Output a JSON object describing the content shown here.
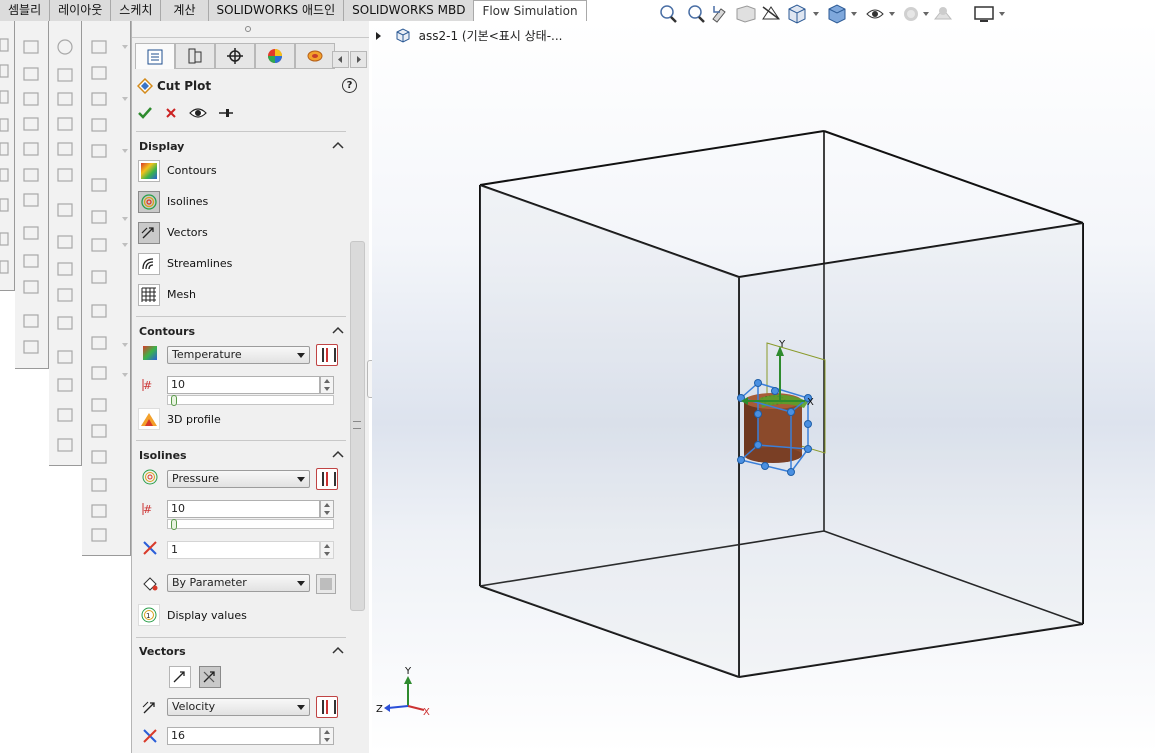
{
  "tabs": [
    {
      "label": "셈블리"
    },
    {
      "label": "레이아웃"
    },
    {
      "label": "스케치"
    },
    {
      "label": "계산"
    },
    {
      "label": "SOLIDWORKS 애드인"
    },
    {
      "label": "SOLIDWORKS MBD"
    },
    {
      "label": "Flow Simulation"
    }
  ],
  "tree": {
    "item_label": "ass2-1  (기본<표시 상태-..."
  },
  "panel": {
    "title": "Cut Plot",
    "help": "?",
    "display": {
      "title": "Display",
      "items": [
        {
          "label": "Contours",
          "icon": "contours-icon",
          "pressed": false
        },
        {
          "label": "Isolines",
          "icon": "isolines-icon",
          "pressed": true
        },
        {
          "label": "Vectors",
          "icon": "vectors-icon",
          "pressed": true
        },
        {
          "label": "Streamlines",
          "icon": "streamlines-icon",
          "pressed": false
        },
        {
          "label": "Mesh",
          "icon": "mesh-icon",
          "pressed": false
        }
      ]
    },
    "contours": {
      "title": "Contours",
      "parameter": "Temperature",
      "levels": "10",
      "profile_label": "3D profile"
    },
    "isolines": {
      "title": "Isolines",
      "parameter": "Pressure",
      "levels": "10",
      "width": "1",
      "color_mode": "By Parameter",
      "display_values_label": "Display values"
    },
    "vectors": {
      "title": "Vectors",
      "parameter": "Velocity",
      "count": "16"
    }
  },
  "triad": {
    "y": "Y",
    "z": "Z",
    "x": "X"
  },
  "part_triad": {
    "y": "Y",
    "x": "X"
  },
  "colors": {
    "accent_green": "#2e8b2e",
    "cancel_red": "#cc2222",
    "part_brown": "#8b4a2b",
    "select_blue": "#3a7fd9"
  }
}
